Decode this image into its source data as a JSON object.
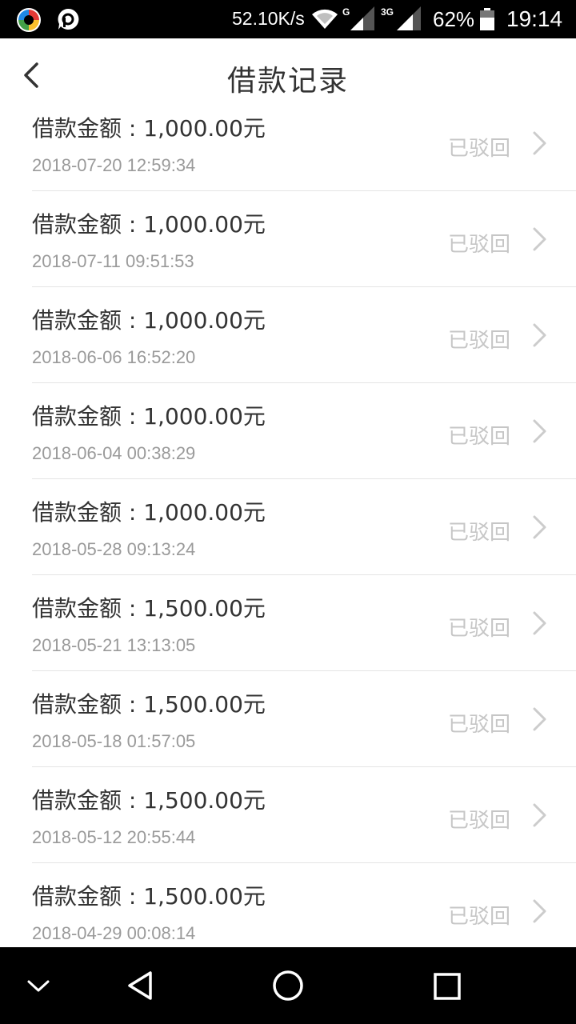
{
  "status_bar": {
    "net_speed": "52.10K/s",
    "signal1_label": "G",
    "signal2_label": "3G",
    "battery": "62%",
    "time": "19:14"
  },
  "header": {
    "title": "借款记录"
  },
  "records": [
    {
      "amount": "借款金额 : 1,000.00元",
      "date": "2018-07-20 12:59:34",
      "status": "已驳回"
    },
    {
      "amount": "借款金额 : 1,000.00元",
      "date": "2018-07-11 09:51:53",
      "status": "已驳回"
    },
    {
      "amount": "借款金额 : 1,000.00元",
      "date": "2018-06-06 16:52:20",
      "status": "已驳回"
    },
    {
      "amount": "借款金额 : 1,000.00元",
      "date": "2018-06-04 00:38:29",
      "status": "已驳回"
    },
    {
      "amount": "借款金额 : 1,000.00元",
      "date": "2018-05-28 09:13:24",
      "status": "已驳回"
    },
    {
      "amount": "借款金额 : 1,500.00元",
      "date": "2018-05-21 13:13:05",
      "status": "已驳回"
    },
    {
      "amount": "借款金额 : 1,500.00元",
      "date": "2018-05-18 01:57:05",
      "status": "已驳回"
    },
    {
      "amount": "借款金额 : 1,500.00元",
      "date": "2018-05-12 20:55:44",
      "status": "已驳回"
    },
    {
      "amount": "借款金额 : 1,500.00元",
      "date": "2018-04-29 00:08:14",
      "status": "已驳回"
    }
  ],
  "icons": {
    "back": "chevron-left-icon",
    "row_arrow": "chevron-right-icon",
    "nav": [
      "chevron-down-icon",
      "back-triangle-icon",
      "home-circle-icon",
      "recents-square-icon"
    ]
  },
  "colors": {
    "text_primary": "#333333",
    "text_secondary": "#9a9a9a",
    "status_rejected": "#c6c6c6",
    "divider": "#e3e3e3"
  }
}
